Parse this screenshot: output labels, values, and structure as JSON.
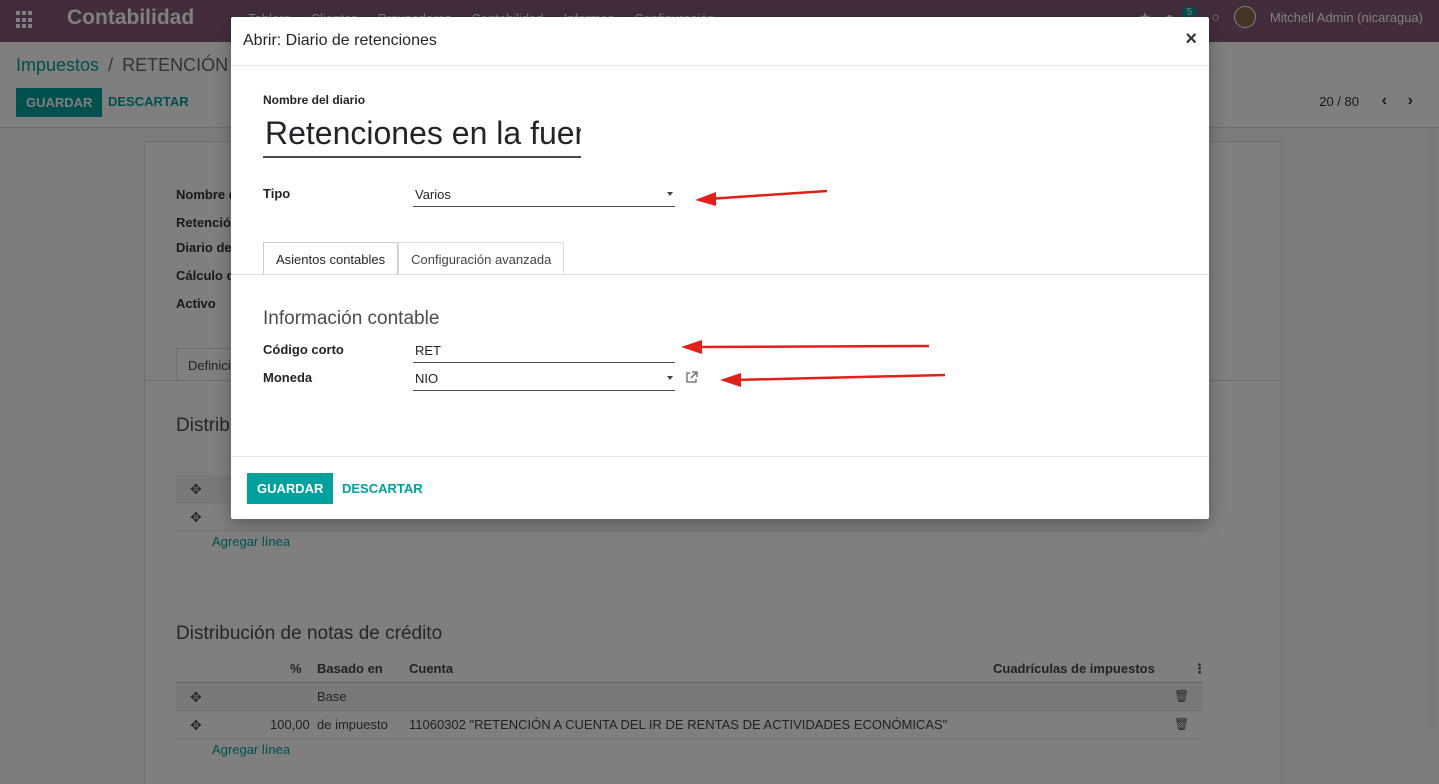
{
  "navbar": {
    "brand": "Contabilidad",
    "menu": [
      "Tablero",
      "Clientes",
      "Proveedores",
      "Contabilidad",
      "Informes",
      "Configuración"
    ],
    "message_count": "5",
    "user": "Mitchell Admin (nicaragua)"
  },
  "control": {
    "breadcrumb_parent": "Impuestos",
    "breadcrumb_sep": "/",
    "breadcrumb_current": "RETENCIÓN C",
    "save_label": "GUARDAR",
    "discard_label": "DESCARTAR",
    "pager": "20 / 80"
  },
  "background_form": {
    "labels": [
      "Nombre d",
      "Retención",
      "Diario de",
      "Cálculo d",
      "Activo"
    ],
    "tab_label": "Definici",
    "section1_title": "Distrib",
    "section2_title": "Distribución de notas de crédito",
    "table_headers": {
      "percent": "%",
      "based_on": "Basado en",
      "account": "Cuenta",
      "tax_grids": "Cuadrículas de impuestos"
    },
    "rows": [
      {
        "percent": "",
        "based_on": "Base",
        "account": ""
      },
      {
        "percent": "100,00",
        "based_on": "de impuesto",
        "account": "11060302 \"RETENCIÓN A CUENTA DEL IR DE RENTAS DE ACTIVIDADES ECONÓMICAS\""
      }
    ],
    "add_line": "Agregar línea"
  },
  "modal": {
    "title": "Abrir: Diario de retenciones",
    "close_symbol": "×",
    "journal_name_label": "Nombre del diario",
    "journal_name_value": "Retenciones en la fuen",
    "type_label": "Tipo",
    "type_value": "Varios",
    "tabs": [
      {
        "label": "Asientos contables",
        "active": true
      },
      {
        "label": "Configuración avanzada",
        "active": false
      }
    ],
    "section_title": "Información contable",
    "short_code_label": "Código corto",
    "short_code_value": "RET",
    "currency_label": "Moneda",
    "currency_value": "NIO",
    "save_label": "GUARDAR",
    "discard_label": "DESCARTAR"
  },
  "colors": {
    "navbar": "#875a7b",
    "accent": "#00a09d",
    "arrow": "#e0201b"
  }
}
